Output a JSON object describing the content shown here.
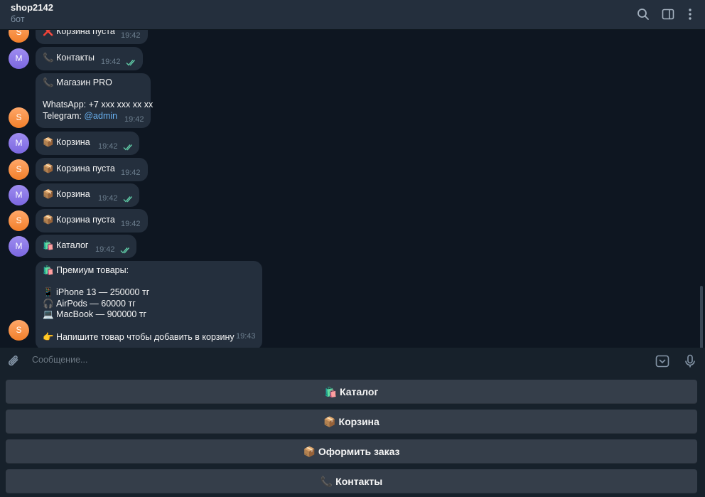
{
  "header": {
    "title": "shop2142",
    "subtitle": "бот",
    "icons": [
      "search-icon",
      "sidebar-toggle-icon",
      "more-vertical-icon"
    ]
  },
  "colors": {
    "background": "#0e1621",
    "bubble": "#242f3d",
    "keyboard_button": "#353e4a",
    "time": "#6d7f8f",
    "read_check": "#5fc9a5",
    "link": "#6ab3f3",
    "avatar_shop": "#f58b3c",
    "avatar_me": "#8a77e8"
  },
  "messages": [
    {
      "avatar": "S",
      "text": "❌ Корзина пуста",
      "time": "19:42",
      "read": false
    },
    {
      "avatar": "M",
      "text": "📞 Контакты",
      "time": "19:42",
      "read": true
    },
    {
      "avatar": "S",
      "text": "📞 Магазин PRO\n\nWhatsApp: +7 xxx xxx xx xx\nTelegram: ",
      "link": "@admin",
      "time": "19:42",
      "read": false
    },
    {
      "avatar": "M",
      "text": "📦 Корзина",
      "time": "19:42",
      "read": true
    },
    {
      "avatar": "S",
      "text": "📦 Корзина пуста",
      "time": "19:42",
      "read": false
    },
    {
      "avatar": "M",
      "text": "📦 Корзина",
      "time": "19:42",
      "read": true
    },
    {
      "avatar": "S",
      "text": "📦 Корзина пуста",
      "time": "19:42",
      "read": false
    },
    {
      "avatar": "M",
      "text": "🛍️ Каталог",
      "time": "19:42",
      "read": true
    },
    {
      "avatar": "S",
      "text": "🛍️ Премиум товары:\n\n📱 iPhone 13 — 250000 тг\n🎧 AirPods — 60000 тг\n💻 MacBook — 900000 тг\n\n👉 Напишите товар чтобы добавить в корзину",
      "time": "19:43",
      "read": false
    }
  ],
  "composer": {
    "placeholder": "Сообщение..."
  },
  "keyboard": {
    "buttons": [
      "🛍️ Каталог",
      "📦 Корзина",
      "📦 Оформить заказ",
      "📞 Контакты"
    ]
  }
}
